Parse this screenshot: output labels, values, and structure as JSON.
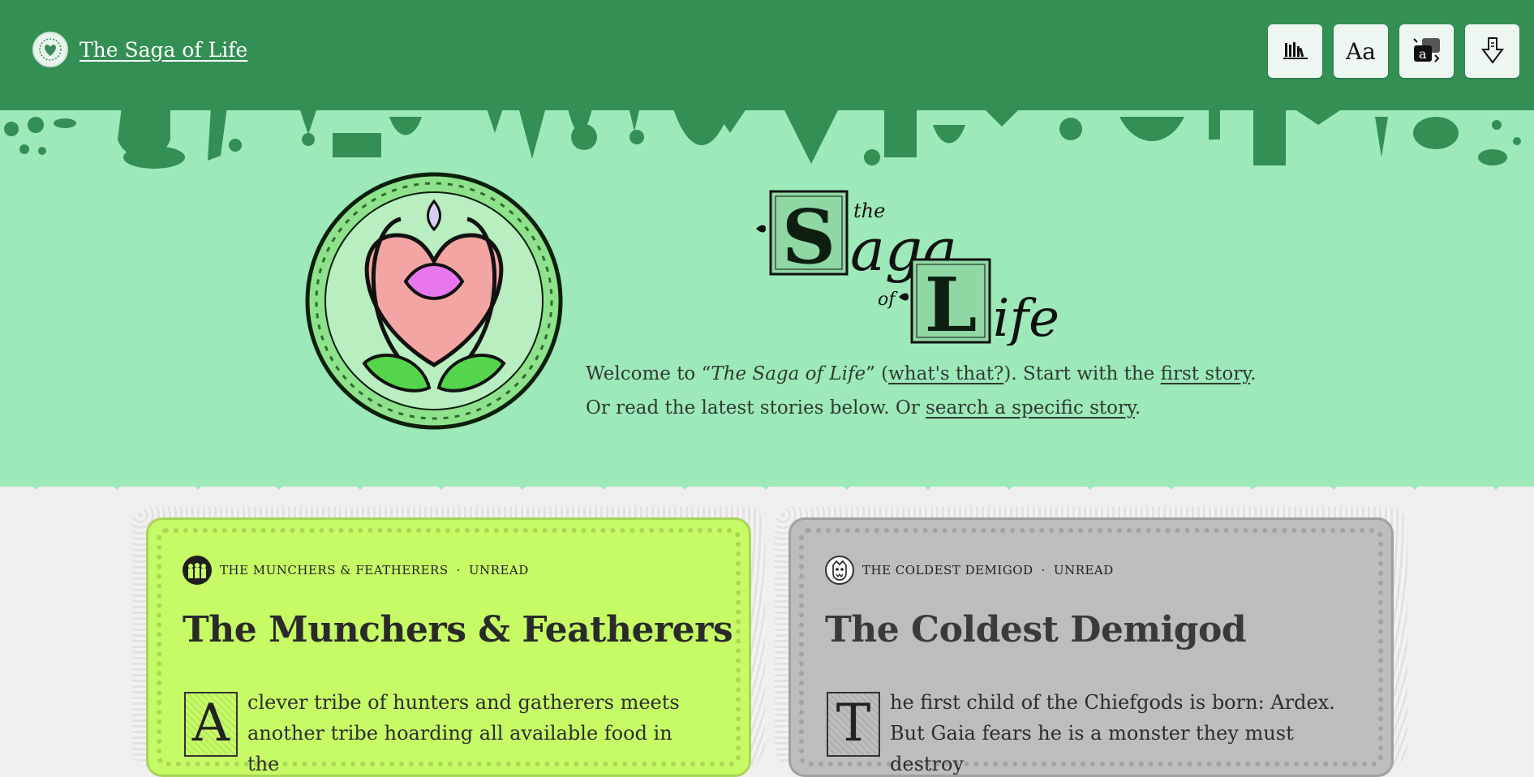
{
  "header": {
    "site_title": "The Saga of Life",
    "logo_icon": "heart-emblem-icon",
    "background": "#348f55",
    "tool_buttons": [
      {
        "name": "library-button",
        "icon": "bookshelf-icon"
      },
      {
        "name": "font-button",
        "icon": "font-icon",
        "glyph": "Aa"
      },
      {
        "name": "translate-button",
        "icon": "translate-icon",
        "glyph": "a"
      },
      {
        "name": "download-button",
        "icon": "download-arrow-icon"
      }
    ]
  },
  "hero": {
    "background": "#9de9b9",
    "title_art": {
      "the": "the",
      "saga_initial": "S",
      "saga_rest": "aga",
      "of": "of",
      "life_initial": "L",
      "life_rest": "ife"
    },
    "welcome": {
      "line1_prefix": "Welcome to “",
      "line1_title": "The Saga of Life",
      "line1_mid": "” (",
      "whats_that_link": "what's that?",
      "line1_after": "). Start with the ",
      "first_story_link": "first story",
      "line1_end": ".",
      "line2_prefix": "Or read the latest stories below. Or ",
      "search_link": "search a specific story",
      "line2_end": "."
    }
  },
  "cards": [
    {
      "series": "THE MUNCHERS & FEATHERERS",
      "separator": "·",
      "status": "UNREAD",
      "title": "The Munchers & Featherers",
      "dropcap": "A",
      "excerpt": "clever tribe of hunters and gatherers meets another tribe hoarding all available food in the",
      "color": "#c6fb66"
    },
    {
      "series": "THE COLDEST DEMIGOD",
      "separator": "·",
      "status": "UNREAD",
      "title": "The Coldest Demigod",
      "dropcap": "T",
      "excerpt": "he first child of the Chiefgods is born: Ardex. But Gaia fears he is a monster they must destroy",
      "color": "#bdbdbd"
    }
  ]
}
